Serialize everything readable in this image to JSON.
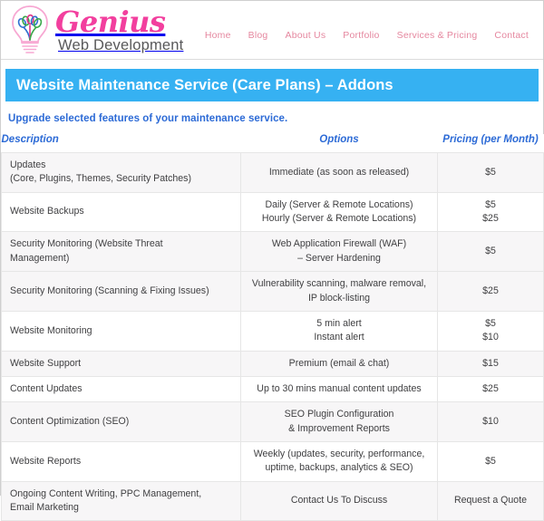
{
  "brand": {
    "name": "Genius",
    "tagline": "Web Development",
    "logo_icon": "lightbulb-icon",
    "name_color": "#f23f9e",
    "tagline_color": "#58585a"
  },
  "nav": {
    "items": [
      {
        "label": "Home"
      },
      {
        "label": "Blog"
      },
      {
        "label": "About Us"
      },
      {
        "label": "Portfolio"
      },
      {
        "label": "Services & Pricing"
      },
      {
        "label": "Contact"
      }
    ],
    "link_color": "#e5879f"
  },
  "banner": {
    "title": "Website Maintenance Service (Care Plans) – Addons",
    "background_color": "#36b1f2",
    "text_color": "#ffffff"
  },
  "intro": {
    "text": "Upgrade selected features of your maintenance service.",
    "color": "#2d6bd6"
  },
  "table": {
    "headers": {
      "description": "Description",
      "options": "Options",
      "pricing": "Pricing (per Month)"
    },
    "header_color": "#2d6bd6",
    "rows": [
      {
        "description_line1": "Updates",
        "description_line2": "(Core, Plugins, Themes, Security Patches)",
        "option_line1": "Immediate (as soon as released)",
        "option_line2": "",
        "price1": "$5",
        "price2": "",
        "shaded": true
      },
      {
        "description_line1": "Website Backups",
        "description_line2": "",
        "option_line1": "Daily (Server & Remote Locations)",
        "option_line2": "Hourly (Server & Remote Locations)",
        "price1": "$5",
        "price2": "$25",
        "shaded": false
      },
      {
        "description_line1": "Security Monitoring (Website Threat",
        "description_line2": "Management)",
        "option_line1": "Web Application Firewall (WAF)",
        "option_line2": "– Server Hardening",
        "price1": "$5",
        "price2": "",
        "shaded": true
      },
      {
        "description_line1": "Security Monitoring (Scanning & Fixing Issues)",
        "description_line2": "",
        "option_line1": "Vulnerability scanning, malware removal,",
        "option_line2": "IP block-listing",
        "price1": "$25",
        "price2": "",
        "shaded": true
      },
      {
        "description_line1": "Website Monitoring",
        "description_line2": "",
        "option_line1": "5 min alert",
        "option_line2": "Instant alert",
        "price1": "$5",
        "price2": "$10",
        "shaded": false
      },
      {
        "description_line1": "Website Support",
        "description_line2": "",
        "option_line1": "Premium (email & chat)",
        "option_line2": "",
        "price1": "$15",
        "price2": "",
        "shaded": true
      },
      {
        "description_line1": "Content Updates",
        "description_line2": "",
        "option_line1": "Up to 30 mins manual content updates",
        "option_line2": "",
        "price1": "$25",
        "price2": "",
        "shaded": false
      },
      {
        "description_line1": "Content Optimization (SEO)",
        "description_line2": "",
        "option_line1": "SEO Plugin Configuration",
        "option_line2": "& Improvement Reports",
        "price1": "$10",
        "price2": "",
        "shaded": true
      },
      {
        "description_line1": "Website Reports",
        "description_line2": "",
        "option_line1": "Weekly (updates, security, performance,",
        "option_line2": "uptime, backups, analytics & SEO)",
        "price1": "$5",
        "price2": "",
        "shaded": false
      },
      {
        "description_line1": "Ongoing Content Writing, PPC Management,",
        "description_line2": "Email Marketing",
        "option_line1": "Contact Us To Discuss",
        "option_line2": "",
        "price1": "Request a Quote",
        "price2": "",
        "shaded": true
      }
    ]
  }
}
